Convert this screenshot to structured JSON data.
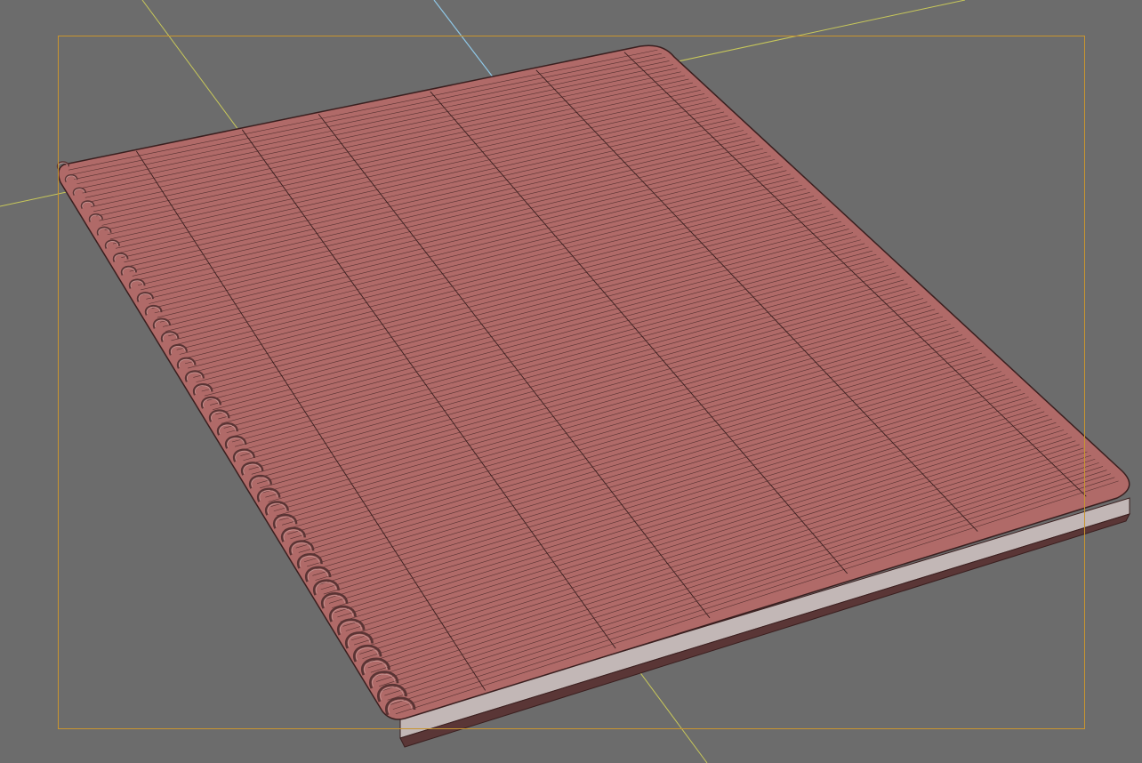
{
  "viewport": {
    "background_color": "#6c6c6c",
    "safe_frame_color": "#c9952f",
    "grid_axis_color": "#c8c85a",
    "vertical_axis_color": "#8fc7e6"
  },
  "model": {
    "name": "spiral-notebook",
    "cover_color": "#b06a68",
    "cover_edge_color": "#3a1f1f",
    "page_block_color": "#c2b7b6",
    "spiral_color": "#5a3434",
    "spiral_ring_count": 42
  }
}
